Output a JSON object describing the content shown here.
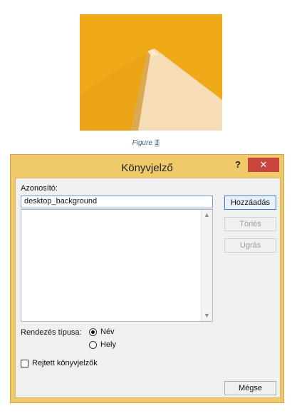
{
  "figure": {
    "label": "Figure",
    "number": "1"
  },
  "dialog": {
    "title": "Könyvjelző",
    "help_label": "?",
    "close_label": "✕",
    "fields": {
      "name_label": "Azonosító:",
      "name_value": "desktop_background"
    },
    "buttons": {
      "add": "Hozzáadás",
      "delete": "Törlés",
      "goto": "Ugrás",
      "cancel": "Mégse"
    },
    "sort": {
      "label": "Rendezés típusa:",
      "options": [
        {
          "label": "Név",
          "selected": true
        },
        {
          "label": "Hely",
          "selected": false
        }
      ]
    },
    "hidden": {
      "label": "Rejtett könyvjelzők",
      "checked": false
    },
    "scroll": {
      "up_icon": "▲",
      "down_icon": "▼"
    }
  }
}
